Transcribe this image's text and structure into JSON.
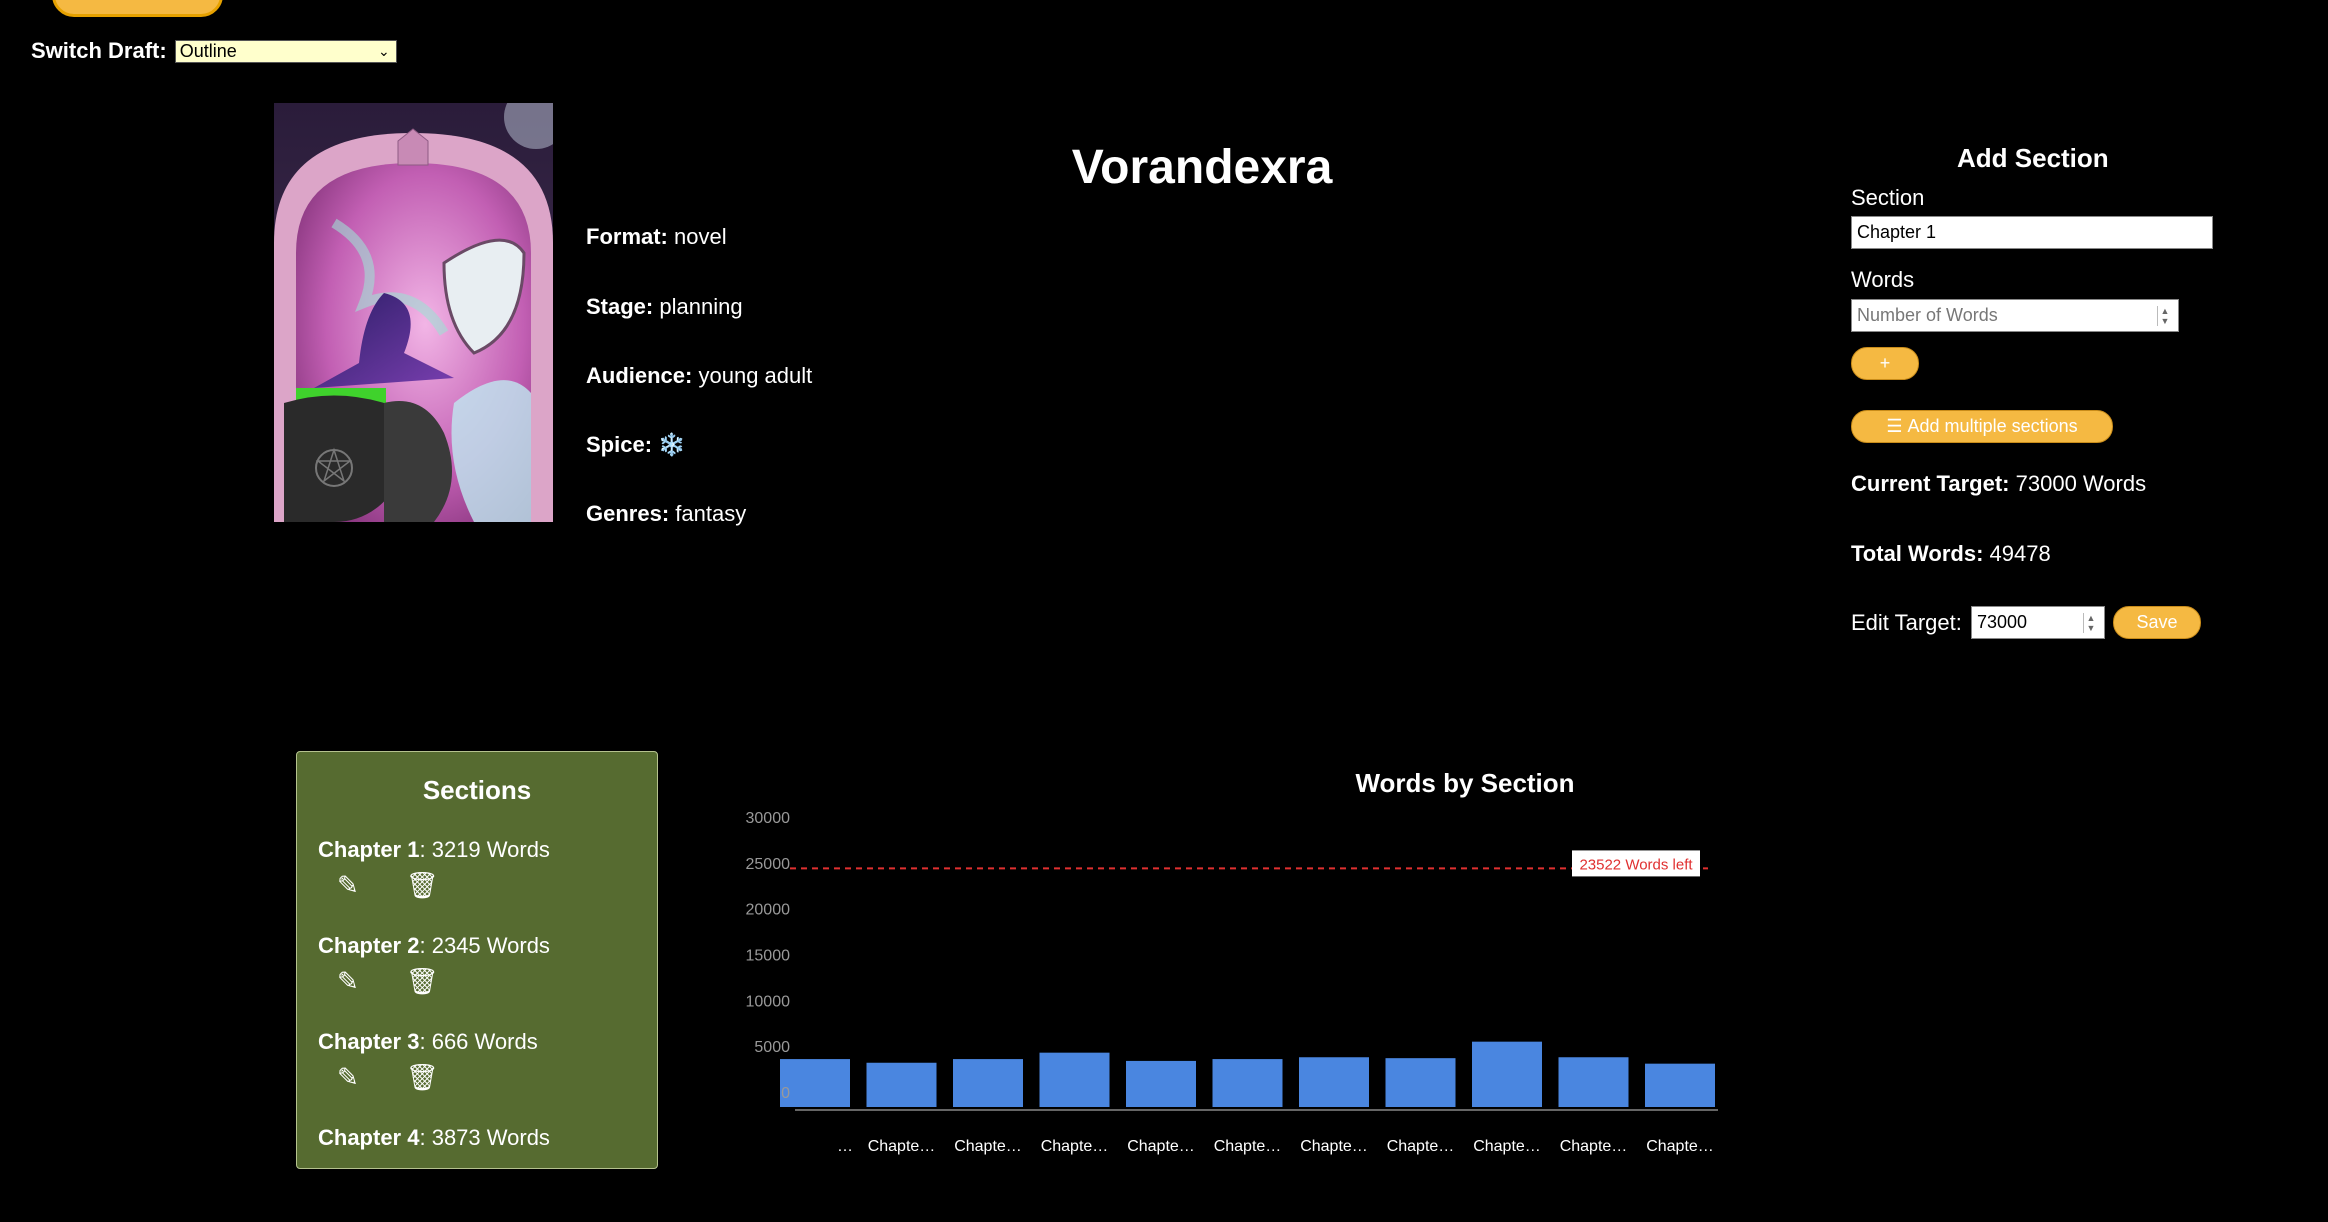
{
  "switch_draft": {
    "label": "Switch Draft:",
    "selected": "Outline"
  },
  "project": {
    "title": "Vorandexra",
    "format_label": "Format:",
    "format": "novel",
    "stage_label": "Stage:",
    "stage": "planning",
    "audience_label": "Audience:",
    "audience": "young adult",
    "spice_label": "Spice:",
    "spice": "❄️",
    "genres_label": "Genres:",
    "genres": "fantasy"
  },
  "add_section": {
    "title": "Add Section",
    "section_label": "Section",
    "section_value": "Chapter 1",
    "words_label": "Words",
    "words_placeholder": "Number of Words",
    "add_button": "+",
    "add_multiple_button": "Add multiple sections",
    "current_target_label": "Current Target:",
    "current_target_value": "73000 Words",
    "total_words_label": "Total Words:",
    "total_words_value": "49478",
    "edit_target_label": "Edit Target:",
    "edit_target_value": "73000",
    "save_button": "Save"
  },
  "sections_panel": {
    "title": "Sections",
    "items": [
      {
        "name": "Chapter 1",
        "words": ": 3219 Words"
      },
      {
        "name": "Chapter 2",
        "words": ": 2345 Words"
      },
      {
        "name": "Chapter 3",
        "words": ": 666 Words"
      },
      {
        "name": "Chapter 4",
        "words": ": 3873 Words"
      }
    ],
    "edit_icon": "✎",
    "delete_icon": "🗑"
  },
  "chart_data": {
    "type": "bar",
    "title": "Words by Section",
    "categories": [
      "…",
      "Chapte…",
      "Chapte…",
      "Chapte…",
      "Chapte…",
      "Chapte…",
      "Chapte…",
      "Chapte…",
      "Chapte…",
      "Chapte…",
      "Chapte…"
    ],
    "values": [
      3700,
      3300,
      3700,
      4400,
      3500,
      3700,
      3900,
      3800,
      5600,
      3900,
      3200
    ],
    "ylim": [
      0,
      30000
    ],
    "yticks": [
      0,
      5000,
      10000,
      15000,
      20000,
      25000,
      30000
    ],
    "target_line": 24500,
    "target_label": "23522 Words left",
    "bar_color": "#4a86e0",
    "target_color": "#e03030",
    "grid": false
  },
  "colors": {
    "accent_yellow": "#f5b942",
    "sections_panel_bg": "#566b30",
    "background": "#000000"
  }
}
